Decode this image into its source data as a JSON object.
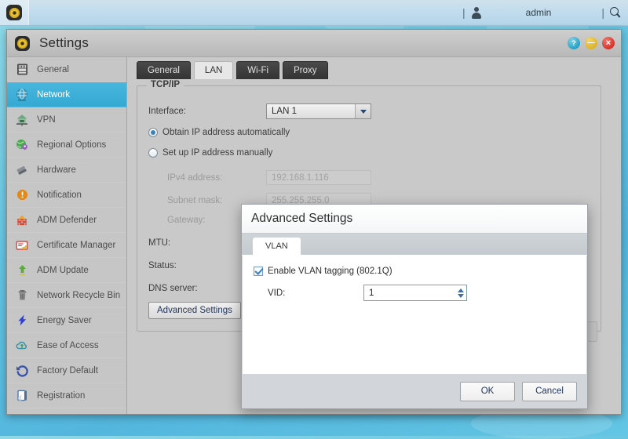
{
  "taskbar": {
    "launcher_icon": "settings-app-icon",
    "separator": "|",
    "user_icon": "user-icon",
    "user_name": "admin",
    "search_icon": "search-icon"
  },
  "window": {
    "title": "Settings",
    "icon": "settings-app-icon",
    "buttons": {
      "help": "?",
      "minimize": "—",
      "close": "×"
    }
  },
  "sidebar": {
    "items": [
      {
        "label": "General",
        "icon": "server-icon",
        "active": false
      },
      {
        "label": "Network",
        "icon": "globe-icon",
        "active": true
      },
      {
        "label": "VPN",
        "icon": "house-network-icon",
        "active": false
      },
      {
        "label": "Regional Options",
        "icon": "globe-pin-icon",
        "active": false
      },
      {
        "label": "Hardware",
        "icon": "chip-stack-icon",
        "active": false
      },
      {
        "label": "Notification",
        "icon": "alert-circle-icon",
        "active": false
      },
      {
        "label": "ADM Defender",
        "icon": "firewall-icon",
        "active": false
      },
      {
        "label": "Certificate Manager",
        "icon": "certificate-icon",
        "active": false
      },
      {
        "label": "ADM Update",
        "icon": "upload-arrow-icon",
        "active": false
      },
      {
        "label": "Network Recycle Bin",
        "icon": "trash-icon",
        "active": false
      },
      {
        "label": "Energy Saver",
        "icon": "lightning-bolt-icon",
        "active": false
      },
      {
        "label": "Ease of Access",
        "icon": "cloud-access-icon",
        "active": false
      },
      {
        "label": "Factory Default",
        "icon": "undo-arrow-icon",
        "active": false
      },
      {
        "label": "Registration",
        "icon": "clipboard-icon",
        "active": false
      }
    ]
  },
  "tabs": [
    {
      "label": "General",
      "active": false
    },
    {
      "label": "LAN",
      "active": true
    },
    {
      "label": "Wi-Fi",
      "active": false
    },
    {
      "label": "Proxy",
      "active": false
    }
  ],
  "tcpip": {
    "legend": "TCP/IP",
    "interface_label": "Interface:",
    "interface_value": "LAN 1",
    "radio_auto_label": "Obtain IP address automatically",
    "radio_auto_selected": true,
    "radio_manual_label": "Set up IP address manually",
    "radio_manual_selected": false,
    "ipv4_label": "IPv4 address:",
    "ipv4_value": "192.168.1.116",
    "subnet_label": "Subnet mask:",
    "subnet_value": "255.255.255.0",
    "gateway_label": "Gateway:",
    "gateway_value": "",
    "mtu_label": "MTU:",
    "status_label": "Status:",
    "dns_label": "DNS server:",
    "advanced_button": "Advanced Settings"
  },
  "dialog": {
    "title": "Advanced Settings",
    "tabs": [
      {
        "label": "VLAN",
        "active": true
      }
    ],
    "vlan_checkbox_label": "Enable VLAN tagging (802.1Q)",
    "vlan_checkbox_checked": true,
    "vid_label": "VID:",
    "vid_value": "1",
    "ok_label": "OK",
    "cancel_label": "Cancel"
  },
  "watermark": {
    "text": ""
  },
  "colors": {
    "accent": "#34a9d4",
    "desktop": "#63c3e0",
    "window_chrome": "#c9c9c9",
    "tab_dark": "#3a3a3a",
    "close_red": "#d8352b",
    "minimize_yellow": "#ddb42c",
    "help_blue": "#27a3c6"
  }
}
